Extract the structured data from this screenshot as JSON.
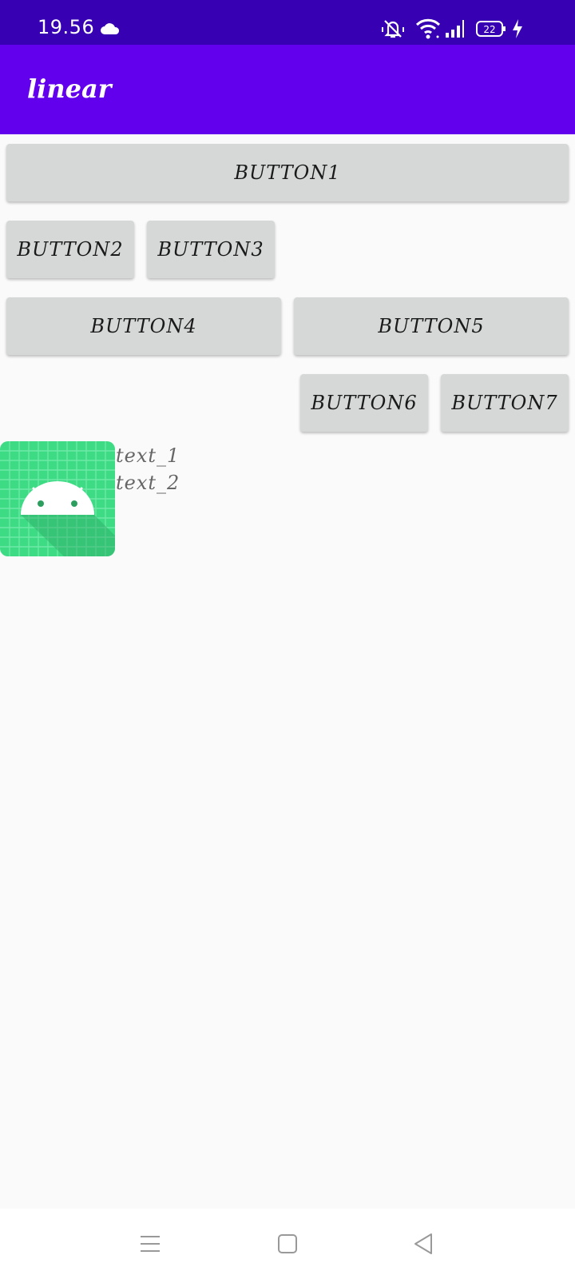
{
  "status_bar": {
    "time": "19.56",
    "battery_level": "22"
  },
  "app_bar": {
    "title": "linear"
  },
  "buttons": {
    "b1": "BUTTON1",
    "b2": "BUTTON2",
    "b3": "BUTTON3",
    "b4": "BUTTON4",
    "b5": "BUTTON5",
    "b6": "BUTTON6",
    "b7": "BUTTON7"
  },
  "texts": {
    "text1": "text_1",
    "text2": "text_2"
  },
  "colors": {
    "status_bar": "#3700b3",
    "app_bar": "#6200ee",
    "button_bg": "#d6d7d7",
    "icon_bg": "#3ddc84"
  }
}
